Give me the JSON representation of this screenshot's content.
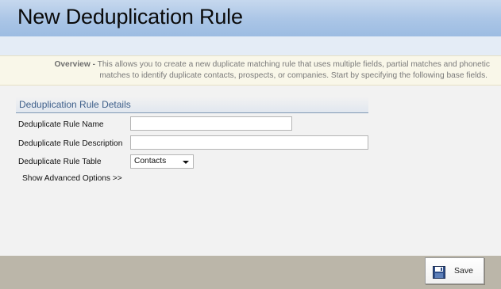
{
  "header": {
    "title": "New Deduplication Rule"
  },
  "overview": {
    "label": "Overview -",
    "line1": "This allows you to create a new duplicate matching rule that uses multiple fields, partial matches and phonetic",
    "line2": "matches to identify duplicate contacts, prospects, or companies. Start by specifying the following base fields."
  },
  "section": {
    "title": "Deduplication Rule Details"
  },
  "fields": {
    "name_label": "Deduplicate Rule Name",
    "name_value": "",
    "description_label": "Deduplicate Rule Description",
    "description_value": "",
    "table_label": "Deduplicate Rule Table",
    "table_value": "Contacts"
  },
  "advanced_link": "Show Advanced Options >>",
  "footer": {
    "save_label": "Save",
    "save_icon": "floppy-disk-icon"
  },
  "colors": {
    "header_blue": "#aac5e6",
    "overview_bg": "#f9f7e9",
    "section_title": "#3e5f8a",
    "footer_bg": "#bbb6a9"
  }
}
